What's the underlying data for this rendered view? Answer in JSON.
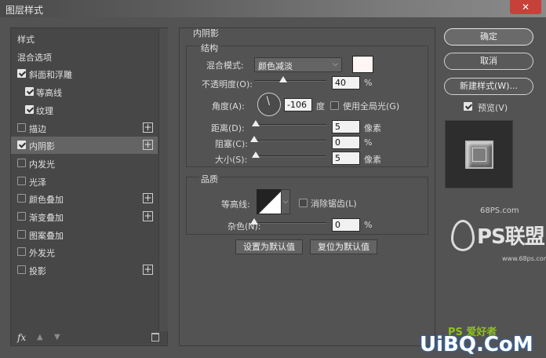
{
  "window": {
    "title": "图层样式",
    "close_label": "✕"
  },
  "styles": {
    "items": [
      {
        "label": "样式",
        "checkbox": false,
        "checked": false,
        "plus": false
      },
      {
        "label": "混合选项",
        "checkbox": false,
        "checked": false,
        "plus": false
      },
      {
        "label": "斜面和浮雕",
        "checkbox": true,
        "checked": true,
        "plus": false
      },
      {
        "label": "等高线",
        "checkbox": true,
        "checked": true,
        "plus": false,
        "indent": true
      },
      {
        "label": "纹理",
        "checkbox": true,
        "checked": true,
        "plus": false,
        "indent": true
      },
      {
        "label": "描边",
        "checkbox": true,
        "checked": false,
        "plus": true
      },
      {
        "label": "内阴影",
        "checkbox": true,
        "checked": true,
        "plus": true,
        "selected": true
      },
      {
        "label": "内发光",
        "checkbox": true,
        "checked": false,
        "plus": false
      },
      {
        "label": "光泽",
        "checkbox": true,
        "checked": false,
        "plus": false
      },
      {
        "label": "颜色叠加",
        "checkbox": true,
        "checked": false,
        "plus": true
      },
      {
        "label": "渐变叠加",
        "checkbox": true,
        "checked": false,
        "plus": true
      },
      {
        "label": "图案叠加",
        "checkbox": true,
        "checked": false,
        "plus": false
      },
      {
        "label": "外发光",
        "checkbox": true,
        "checked": false,
        "plus": false
      },
      {
        "label": "投影",
        "checkbox": true,
        "checked": false,
        "plus": true
      }
    ],
    "fx_label": "fx",
    "up_label": "▲",
    "down_label": "▼"
  },
  "inner_shadow": {
    "panel_title": "内阴影",
    "structure_title": "结构",
    "blend_mode_label": "混合模式:",
    "blend_mode_value": "颜色减淡",
    "blend_color": "#fff5f5",
    "opacity_label": "不透明度(O):",
    "opacity_value": "40",
    "opacity_unit": "%",
    "opacity_fraction": 0.4,
    "angle_label": "角度(A):",
    "angle_value": "-106",
    "angle_unit": "度",
    "global_light_label": "使用全局光(G)",
    "global_light_checked": false,
    "distance_label": "距离(D):",
    "distance_value": "5",
    "distance_unit": "像素",
    "distance_fraction": 0.02,
    "choke_label": "阻塞(C):",
    "choke_value": "0",
    "choke_unit": "%",
    "choke_fraction": 0,
    "size_label": "大小(S):",
    "size_value": "5",
    "size_unit": "像素",
    "size_fraction": 0.02,
    "quality_title": "品质",
    "contour_label": "等高线:",
    "antialias_label": "消除锯齿(L)",
    "antialias_checked": false,
    "noise_label": "杂色(N):",
    "noise_value": "0",
    "noise_unit": "%",
    "noise_fraction": 0,
    "set_default_label": "设置为默认值",
    "reset_default_label": "复位为默认值"
  },
  "actions": {
    "ok_label": "确定",
    "cancel_label": "取消",
    "new_style_label": "新建样式(W)...",
    "preview_label": "预览(V)",
    "preview_checked": true
  },
  "watermarks": {
    "site1": "68PS.com",
    "logo_text": "PS联盟",
    "site1_sub": "www.68ps.com",
    "site2_cn": "PS 爱好者",
    "site2": "UiBQ.CoM"
  }
}
